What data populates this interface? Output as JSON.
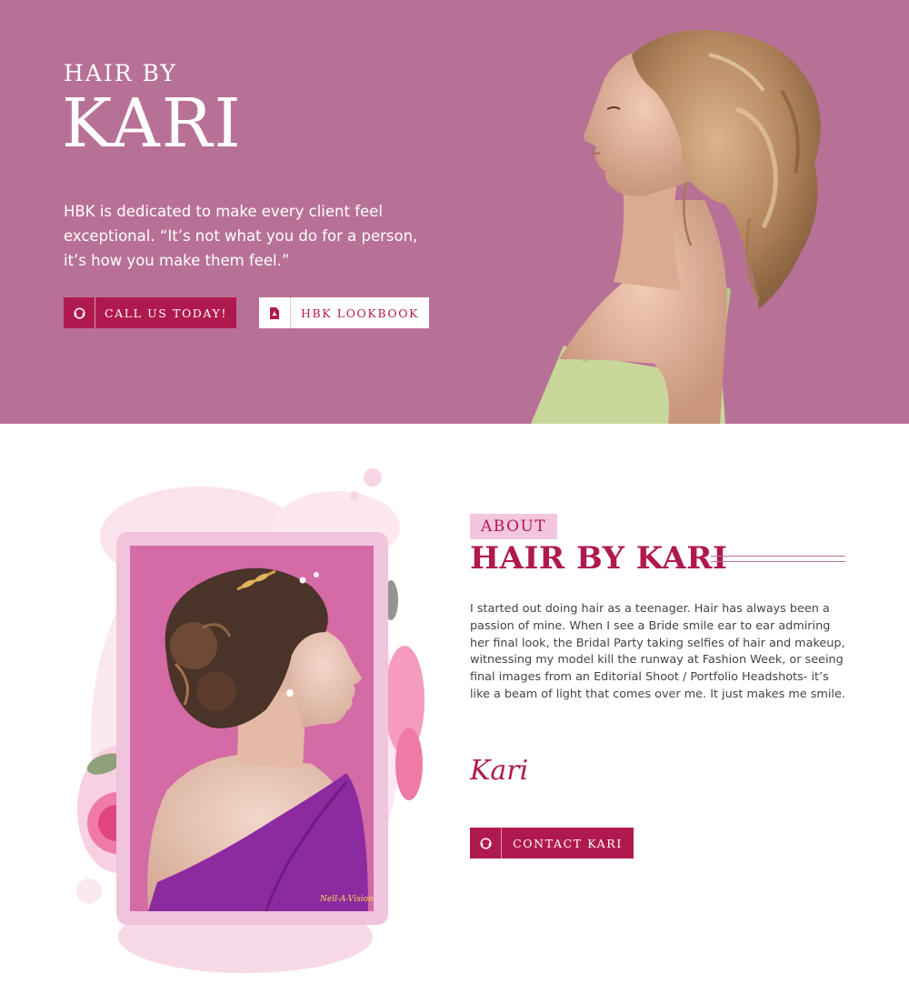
{
  "hero": {
    "kicker": "HAIR BY",
    "title": "KARI",
    "text": "HBK is dedicated to make every client feel exceptional. “It’s not what you do for a person, it’s how you make them feel.”",
    "call_button": {
      "label": "CALL US TODAY!",
      "icon": "headset-icon"
    },
    "lookbook_button": {
      "label": "HBK LOOKBOOK",
      "icon": "pdf-file-icon"
    }
  },
  "about": {
    "tag": "ABOUT",
    "title": "HAIR BY KARI",
    "text": "I started out doing hair as a teenager. Hair has always been a passion of mine. When I see a Bride smile ear to ear admiring her final look, the Bridal Party taking selfies of hair and makeup, witnessing my model kill the runway at Fashion Week, or seeing final images from an Editorial Shoot / Portfolio Headshots- it’s like a beam of light that comes over me. It just makes me smile.",
    "signature": "Kari",
    "photo_credit": "Nell-A-Vision",
    "contact_button": {
      "label": "CONTACT KARI",
      "icon": "headset-icon"
    }
  },
  "colors": {
    "hero_bg": "#b87196",
    "accent": "#b0194f",
    "tag_bg": "#f2c6de",
    "frame": "#f0c4dc"
  }
}
